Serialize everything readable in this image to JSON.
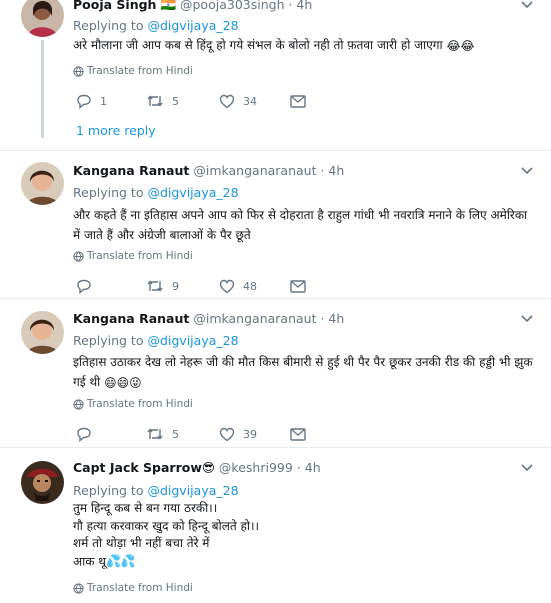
{
  "reply_prefix": "Replying to",
  "translate_label": "Translate from Hindi",
  "more_replies": "1 more reply",
  "tweets": [
    {
      "name": "Pooja Singh",
      "name_suffix": "🇮🇳",
      "handle": "@pooja303singh",
      "time": "· 4h",
      "reply_to": "@digvijaya_28",
      "text": "अरे मौलाना जी आप कब से हिंदू हो गये संभल के बोलो नही तो फ़तवा जारी हो जाएगा",
      "text_emoji": "😂😂",
      "replies": "1",
      "retweets": "5",
      "likes": "34"
    },
    {
      "name": "Kangana Ranaut",
      "handle": "@imkanganaranaut",
      "time": "· 4h",
      "reply_to": "@digvijaya_28",
      "text": "और कहते हैं ना इतिहास अपने आप को फिर से दोहराता है राहुल गांधी भी नवरात्रि मनाने के लिए अमेरिका में जाते हैं और अंग्रेजी बालाओं के पैर छूते",
      "replies": "",
      "retweets": "9",
      "likes": "48"
    },
    {
      "name": "Kangana Ranaut",
      "handle": "@imkanganaranaut",
      "time": "· 4h",
      "reply_to": "@digvijaya_28",
      "text": "इतिहास उठाकर देख लो नेहरू जी की मौत किस बीमारी से हुई थी पैर पैर छूकर उनकी रीड की हड्डी भी झुक गई थी",
      "text_emoji": "😄😄😜",
      "replies": "",
      "retweets": "5",
      "likes": "39"
    },
    {
      "name": "Capt Jack Sparrow",
      "name_suffix": "😎",
      "handle": "@keshri999",
      "time": "· 4h",
      "reply_to": "@digvijaya_28",
      "lines": [
        "तुम हिन्दू कब से बन गया ठरकी।।",
        "गौ हत्या करवाकर खुद को हिन्दू बोलते हो।।",
        "शर्म तो थोड़ा भी नहीं बचा तेरे में",
        "आक थू"
      ],
      "text_emoji": "💦💦"
    }
  ],
  "colors": {
    "link": "#1b95e0",
    "secondary": "#657786",
    "divider": "#e6ecf0",
    "thread": "#ccd6dd"
  },
  "icons": [
    "chevron-down-icon",
    "globe-icon",
    "reply-icon",
    "retweet-icon",
    "heart-icon",
    "message-icon"
  ]
}
